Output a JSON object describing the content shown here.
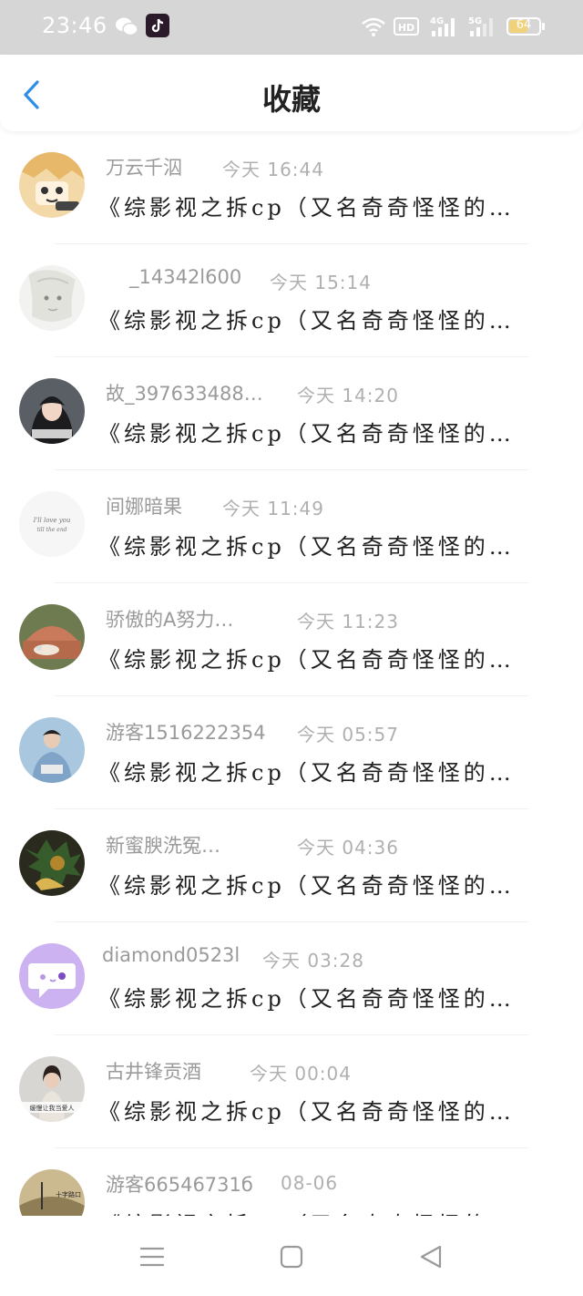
{
  "status_bar": {
    "time": "23:46",
    "battery": "64",
    "battery_level": 0.64,
    "icons": [
      "wechat-icon",
      "tiktok-icon",
      "wifi-icon",
      "hd-icon",
      "4g-signal-icon",
      "5g-signal-icon",
      "battery-icon"
    ]
  },
  "header": {
    "title": "收藏",
    "back_icon": "chevron-left-icon",
    "accent_color": "#2f8ee8"
  },
  "items": [
    {
      "username": "万云千泅",
      "time": "今天 16:44",
      "text": "《综影视之拆cp（又名奇奇怪怪的…"
    },
    {
      "username": "_14342l600",
      "time": "今天 15:14",
      "text": "《综影视之拆cp（又名奇奇怪怪的…"
    },
    {
      "username": "故_397633488…",
      "time": "今天 14:20",
      "text": "《综影视之拆cp（又名奇奇怪怪的…"
    },
    {
      "username": "间娜暗果",
      "time": "今天 11:49",
      "text": "《综影视之拆cp（又名奇奇怪怪的…"
    },
    {
      "username": "骄傲的A努力…",
      "time": "今天 11:23",
      "text": "《综影视之拆cp（又名奇奇怪怪的…"
    },
    {
      "username": "游客1516222354",
      "time": "今天 05:57",
      "text": "《综影视之拆cp（又名奇奇怪怪的…"
    },
    {
      "username": "新蜜腴洗冤…",
      "time": "今天 04:36",
      "text": "《综影视之拆cp（又名奇奇怪怪的…"
    },
    {
      "username": "diamond0523l",
      "time": "今天 03:28",
      "text": "《综影视之拆cp（又名奇奇怪怪的…"
    },
    {
      "username": "古井锋贡酒",
      "time": "今天 00:04",
      "text": "《综影视之拆cp（又名奇奇怪怪的…"
    },
    {
      "username": "游客66546731б",
      "time": "08-06",
      "text": "《综影视之拆cp（又名奇奇怪怪的…"
    }
  ],
  "avatar_texts": {
    "a4_line1": "I'll love you",
    "a4_line2": "till the end",
    "a9_caption": "缓慢让我当爱人",
    "a10_caption": "十字路口"
  },
  "nav_bar": {
    "icons": [
      "menu-icon",
      "home-square-icon",
      "back-triangle-icon"
    ]
  }
}
